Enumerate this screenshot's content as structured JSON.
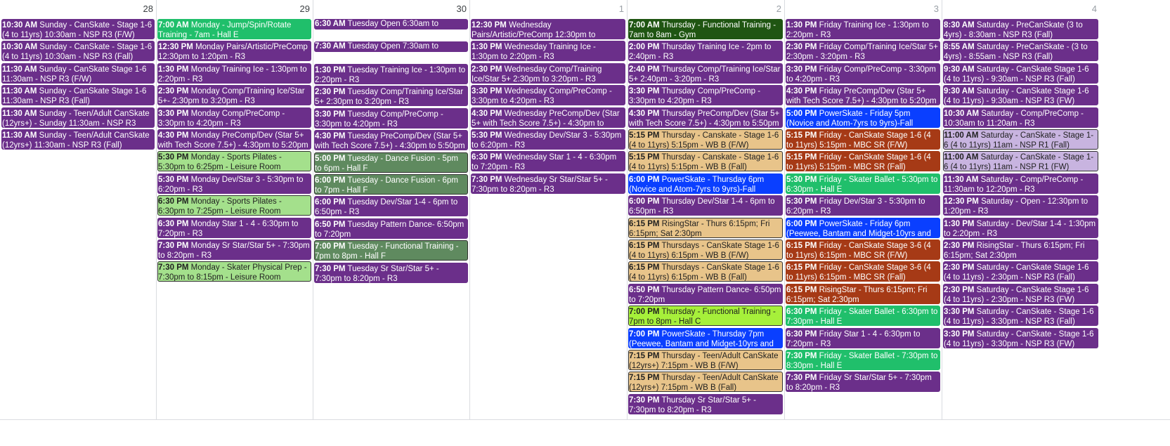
{
  "colors": {
    "purple": "#6b2f8a",
    "green": "#20bf6b",
    "light_green": "#a4e08c",
    "sage": "#5f8a5f",
    "dark_green": "#1f5512",
    "lime": "#a6f03a",
    "blue": "#0a3fff",
    "tan": "#e8c48a",
    "rust": "#a63a16",
    "lavender": "#c8b4e0"
  },
  "days": [
    {
      "number": "28",
      "dim": false,
      "events": [
        {
          "time": "10:30 AM",
          "title": "Sunday - CanSkate - Stage 1-6 (4 to 11yrs) 10:30am - NSP R3 (F/W)",
          "color": "purple"
        },
        {
          "time": "10:30 AM",
          "title": "Sunday - CanSkate - Stage 1-6 (4 to 11yrs) 10:30am - NSP R3 (Fall)",
          "color": "purple"
        },
        {
          "time": "11:30 AM",
          "title": "Sunday - CanSkate Stage 1-6 11:30am - NSP R3 (F/W)",
          "color": "purple"
        },
        {
          "time": "11:30 AM",
          "title": "Sunday - CanSkate Stage 1-6 11:30am - NSP R3 (Fall)",
          "color": "purple"
        },
        {
          "time": "11:30 AM",
          "title": "Sunday - Teen/Adult CanSkate (12yrs+) - Sunday 11:30am - NSP R3 (F/W)",
          "color": "purple"
        },
        {
          "time": "11:30 AM",
          "title": "Sunday - Teen/Adult CanSkate (12yrs+) 11:30am - NSP R3 (Fall)",
          "color": "purple"
        }
      ]
    },
    {
      "number": "29",
      "dim": false,
      "events": [
        {
          "time": "7:00 AM",
          "title": "Monday - Jump/Spin/Rotate Training - 7am - Hall E",
          "color": "green"
        },
        {
          "time": "12:30 PM",
          "title": "Monday Pairs/Artistic/PreComp 12:30pm to 1:20pm - R3",
          "color": "purple"
        },
        {
          "time": "1:30 PM",
          "title": "Monday Training Ice - 1:30pm to 2:20pm - R3",
          "color": "purple"
        },
        {
          "time": "2:30 PM",
          "title": "Monday Comp/Training Ice/Star 5+- 2:30pm to 3:20pm - R3",
          "color": "purple"
        },
        {
          "time": "3:30 PM",
          "title": "Monday Comp/PreComp - 3:30pm to 4:20pm - R3",
          "color": "purple"
        },
        {
          "time": "4:30 PM",
          "title": "Monday PreComp/Dev (Star 5+ with Tech Score 7.5+) - 4:30pm to 5:20pm - R3",
          "color": "purple"
        },
        {
          "time": "5:30 PM",
          "title": "Monday - Sports Pilates - 5:30pm to 6:25pm - Leisure Room",
          "color": "light_green",
          "border": true
        },
        {
          "time": "5:30 PM",
          "title": "Monday Dev/Star 3 - 5:30pm to 6:20pm - R3",
          "color": "purple"
        },
        {
          "time": "6:30 PM",
          "title": "Monday - Sports Pilates - 6:30pm to 7:25pm - Leisure Room",
          "color": "light_green",
          "border": true
        },
        {
          "time": "6:30 PM",
          "title": "Monday Star 1 - 4 - 6:30pm to 7:20pm - R3",
          "color": "purple"
        },
        {
          "time": "7:30 PM",
          "title": "Monday Sr Star/Star 5+ - 7:30pm to 8:20pm - R3",
          "color": "purple"
        },
        {
          "time": "7:30 PM",
          "title": "Monday - Skater Physical Prep - 7:30pm to 8:15pm - Leisure Room",
          "color": "light_green",
          "border": true
        }
      ]
    },
    {
      "number": "30",
      "dim": false,
      "events": [
        {
          "time": "6:30 AM",
          "title": "Tuesday Open 6:30am to 7:20am - R3",
          "color": "purple",
          "single": true
        },
        {
          "time": "7:30 AM",
          "title": "Tuesday Open 7:30am to 8:20am - R3",
          "color": "purple",
          "single": true
        },
        {
          "time": "1:30 PM",
          "title": "Tuesday Training Ice - 1:30pm to 2:20pm - R3",
          "color": "purple"
        },
        {
          "time": "2:30 PM",
          "title": "Tuesday Comp/Training Ice/Star 5+ 2:30pm to 3:20pm - R3",
          "color": "purple"
        },
        {
          "time": "3:30 PM",
          "title": "Tuesday Comp/PreComp - 3:30pm to 4:20pm - R3",
          "color": "purple"
        },
        {
          "time": "4:30 PM",
          "title": "Tuesday PreComp/Dev (Star 5+ with Tech Score 7.5+) - 4:30pm to 5:50pm - R3",
          "color": "purple"
        },
        {
          "time": "5:00 PM",
          "title": "Tuesday - Dance Fusion - 5pm to 6pm - Hall F",
          "color": "sage",
          "border": true
        },
        {
          "time": "6:00 PM",
          "title": "Tuesday - Dance Fusion - 6pm to 7pm - Hall F",
          "color": "sage",
          "border": true
        },
        {
          "time": "6:00 PM",
          "title": "Tuesday Dev/Star 1-4 - 6pm to 6:50pm - R3",
          "color": "purple"
        },
        {
          "time": "6:50 PM",
          "title": "Tuesday Pattern Dance- 6:50pm to 7:20pm",
          "color": "purple"
        },
        {
          "time": "7:00 PM",
          "title": "Tuesday - Functional Training - 7pm to 8pm - Hall F",
          "color": "sage",
          "border": true
        },
        {
          "time": "7:30 PM",
          "title": "Tuesday Sr Star/Star 5+ - 7:30pm to 8:20pm - R3",
          "color": "purple"
        }
      ]
    },
    {
      "number": "1",
      "dim": true,
      "events": [
        {
          "time": "12:30 PM",
          "title": "Wednesday Pairs/Artistic/PreComp 12:30pm to 1:20pm - R3",
          "color": "purple"
        },
        {
          "time": "1:30 PM",
          "title": "Wednesday Training Ice - 1:30pm to 2:20pm - R3",
          "color": "purple"
        },
        {
          "time": "2:30 PM",
          "title": "Wednesday Comp/Training Ice/Star 5+ 2:30pm to 3:20pm - R3",
          "color": "purple"
        },
        {
          "time": "3:30 PM",
          "title": "Wednesday Comp/PreComp - 3:30pm to 4:20pm - R3",
          "color": "purple"
        },
        {
          "time": "4:30 PM",
          "title": "Wednesday PreComp/Dev (Star 5+ with Tech Score 7.5+) - 4:30pm to 5:20pm - R3",
          "color": "purple"
        },
        {
          "time": "5:30 PM",
          "title": "Wednesday Dev/Star 3 - 5:30pm to 6:20pm - R3",
          "color": "purple"
        },
        {
          "time": "6:30 PM",
          "title": "Wednesday Star 1 - 4 - 6:30pm to 7:20pm - R3",
          "color": "purple"
        },
        {
          "time": "7:30 PM",
          "title": "Wednesday Sr Star/Star 5+ - 7:30pm to 8:20pm - R3",
          "color": "purple"
        }
      ]
    },
    {
      "number": "2",
      "dim": true,
      "events": [
        {
          "time": "7:00 AM",
          "title": "Thursday - Functional Training - 7am to 8am - Gym",
          "color": "dark_green"
        },
        {
          "time": "2:00 PM",
          "title": "Thursday Training Ice - 2pm to 2:40pm - R3",
          "color": "purple"
        },
        {
          "time": "2:40 PM",
          "title": "Thursday Comp/Training Ice/Star 5+ 2:40pm - 3:20pm - R3",
          "color": "purple"
        },
        {
          "time": "3:30 PM",
          "title": "Thursday Comp/PreComp - 3:30pm to 4:20pm - R3",
          "color": "purple"
        },
        {
          "time": "4:30 PM",
          "title": "Thursday PreComp/Dev (Star 5+ with Tech Score 7.5+) - 4:30pm to 5:50pm - R3",
          "color": "purple"
        },
        {
          "time": "5:15 PM",
          "title": "Thursday - Canskate - Stage 1-6 (4 to 11yrs) 5:15pm - WB B (F/W)",
          "color": "tan",
          "border": true
        },
        {
          "time": "5:15 PM",
          "title": "Thursday - Canskate - Stage 1-6 (4 to 11yrs) 5:15pm - WB B (Fall)",
          "color": "tan",
          "border": true
        },
        {
          "time": "6:00 PM",
          "title": "PowerSkate - Thursday 6pm (Novice and Atom-7yrs to 9yrs)-Fall",
          "color": "blue"
        },
        {
          "time": "6:00 PM",
          "title": "Thursday Dev/Star 1-4 - 6pm to 6:50pm - R3",
          "color": "purple"
        },
        {
          "time": "6:15 PM",
          "title": "RisingStar - Thurs 6:15pm; Fri 6:15pm; Sat 2:30pm",
          "color": "tan",
          "border": true
        },
        {
          "time": "6:15 PM",
          "title": "Thursdays - CanSkate Stage 1-6 (4 to 11yrs) 6:15pm - WB B (F/W)",
          "color": "tan",
          "border": true
        },
        {
          "time": "6:15 PM",
          "title": "Thursdays - CanSkate Stage 1-6 (4 to 11yrs) 6:15pm - WB B (Fall)",
          "color": "tan",
          "border": true
        },
        {
          "time": "6:50 PM",
          "title": "Thursday Pattern Dance- 6:50pm to 7:20pm",
          "color": "purple"
        },
        {
          "time": "7:00 PM",
          "title": "Thursday - Functional Training - 7pm to 8pm - Hall C",
          "color": "lime",
          "border": true
        },
        {
          "time": "7:00 PM",
          "title": "PowerSkate - Thursday 7pm (Peewee, Bantam and Midget-10yrs and older)-Fall",
          "color": "blue"
        },
        {
          "time": "7:15 PM",
          "title": "Thursday - Teen/Adult CanSkate (12yrs+) 7:15pm - WB B (F/W)",
          "color": "tan",
          "border": true
        },
        {
          "time": "7:15 PM",
          "title": "Thursday - Teen/Adult CanSkate (12yrs+) 7:15pm - WB B (Fall)",
          "color": "tan",
          "border": true
        },
        {
          "time": "7:30 PM",
          "title": "Thursday Sr Star/Star 5+ - 7:30pm to 8:20pm - R3",
          "color": "purple"
        }
      ]
    },
    {
      "number": "3",
      "dim": true,
      "events": [
        {
          "time": "1:30 PM",
          "title": "Friday Training Ice - 1:30pm to 2:20pm - R3",
          "color": "purple"
        },
        {
          "time": "2:30 PM",
          "title": "Friday Comp/Training Ice/Star 5+ 2:30pm - 3:20pm - R3",
          "color": "purple"
        },
        {
          "time": "3:30 PM",
          "title": "Friday Comp/PreComp - 3:30pm to 4:20pm - R3",
          "color": "purple"
        },
        {
          "time": "4:30 PM",
          "title": "Friday PreComp/Dev (Star 5+ with Tech Score 7.5+) - 4:30pm to 5:20pm - R3",
          "color": "purple"
        },
        {
          "time": "5:00 PM",
          "title": "PowerSkate - Friday 5pm (Novice and Atom-7yrs to 9yrs)-Fall",
          "color": "blue"
        },
        {
          "time": "5:15 PM",
          "title": "Friday - CanSkate Stage 1-6 (4 to 11yrs) 5:15pm - MBC SR (F/W)",
          "color": "rust"
        },
        {
          "time": "5:15 PM",
          "title": "Friday - CanSkate Stage 1-6 (4 to 11yrs) 5:15pm - MBC SR (Fall)",
          "color": "rust"
        },
        {
          "time": "5:30 PM",
          "title": "Friday - Skater Ballet - 5:30pm to 6:30pm - Hall E",
          "color": "green"
        },
        {
          "time": "5:30 PM",
          "title": "Friday Dev/Star 3 - 5:30pm to 6:20pm - R3",
          "color": "purple"
        },
        {
          "time": "6:00 PM",
          "title": "PowerSkate - Friday 6pm (Peewee, Bantam and Midget-10yrs and older)-Fall",
          "color": "blue"
        },
        {
          "time": "6:15 PM",
          "title": "Friday - CanSkate Stage 3-6 (4 to 11yrs) 6:15pm - MBC SR (F/W)",
          "color": "rust"
        },
        {
          "time": "6:15 PM",
          "title": "Friday - CanSkate Stage 3-6 (4 to 11yrs) 6:15pm - MBC SR (Fall)",
          "color": "rust"
        },
        {
          "time": "6:15 PM",
          "title": "RisingStar - Thurs 6:15pm; Fri 6:15pm; Sat 2:30pm",
          "color": "rust"
        },
        {
          "time": "6:30 PM",
          "title": "Friday - Skater Ballet - 6:30pm to 7:30pm - Hall E",
          "color": "green"
        },
        {
          "time": "6:30 PM",
          "title": "Friday Star 1 - 4 - 6:30pm to 7:20pm - R3",
          "color": "purple"
        },
        {
          "time": "7:30 PM",
          "title": "Friday - Skater Ballet - 7:30pm to 8:30pm - Hall E",
          "color": "green"
        },
        {
          "time": "7:30 PM",
          "title": "Friday Sr Star/Star 5+ - 7:30pm to 8:20pm - R3",
          "color": "purple"
        }
      ]
    },
    {
      "number": "4",
      "dim": true,
      "events": [
        {
          "time": "8:30 AM",
          "title": "Saturday - PreCanSkate (3 to 4yrs) - 8:30am - NSP R3 (Fall)",
          "color": "purple"
        },
        {
          "time": "8:55 AM",
          "title": "Saturday - PreCanSkate - (3 to 4yrs) - 8:55am - NSP R3 (Fall)",
          "color": "purple"
        },
        {
          "time": "9:30 AM",
          "title": "Saturday - CanSkate Stage 1-6 (4 to 11yrs) - 9:30am - NSP R3 (Fall)",
          "color": "purple"
        },
        {
          "time": "9:30 AM",
          "title": "Saturday - CanSkate Stage 1-6 (4 to 11yrs) - 9:30am - NSP R3 (FW)",
          "color": "purple"
        },
        {
          "time": "10:30 AM",
          "title": "Saturday - Comp/PreComp - 10:30am to 11:20am - R3",
          "color": "purple"
        },
        {
          "time": "11:00 AM",
          "title": "Saturday - CanSkate - Stage 1-6 (4 to 11yrs) 11am - NSP R1 (Fall)",
          "color": "lavender",
          "border": true
        },
        {
          "time": "11:00 AM",
          "title": "Saturday - CanSkate - Stage 1-6 (4 to 11yrs) 11am - NSP R1 (FW)",
          "color": "lavender",
          "border": true
        },
        {
          "time": "11:30 AM",
          "title": "Saturday - Comp/PreComp - 11:30am to 12:20pm - R3",
          "color": "purple"
        },
        {
          "time": "12:30 PM",
          "title": "Saturday - Open - 12:30pm to 1:20pm - R3",
          "color": "purple"
        },
        {
          "time": "1:30 PM",
          "title": "Saturday - Dev/Star 1-4 - 1:30pm to 2:20pm - R3",
          "color": "purple"
        },
        {
          "time": "2:30 PM",
          "title": "RisingStar - Thurs 6:15pm; Fri 6:15pm; Sat 2:30pm",
          "color": "purple"
        },
        {
          "time": "2:30 PM",
          "title": "Saturday - CanSkate Stage 1-6 (4 to 11yrs) - 2:30pm - NSP R3 (Fall)",
          "color": "purple"
        },
        {
          "time": "2:30 PM",
          "title": "Saturday - CanSkate Stage 1-6 (4 to 11yrs) - 2:30pm - NSP R3 (FW)",
          "color": "purple"
        },
        {
          "time": "3:30 PM",
          "title": "Saturday - CanSkate - Stage 1-6 (4 to 11yrs) - 3:30pm - NSP R3 (Fall)",
          "color": "purple"
        },
        {
          "time": "3:30 PM",
          "title": "Saturday - CanSkate - Stage 1-6 (4 to 11yrs) - 3:30pm - NSP R3 (FW)",
          "color": "purple"
        }
      ]
    }
  ]
}
